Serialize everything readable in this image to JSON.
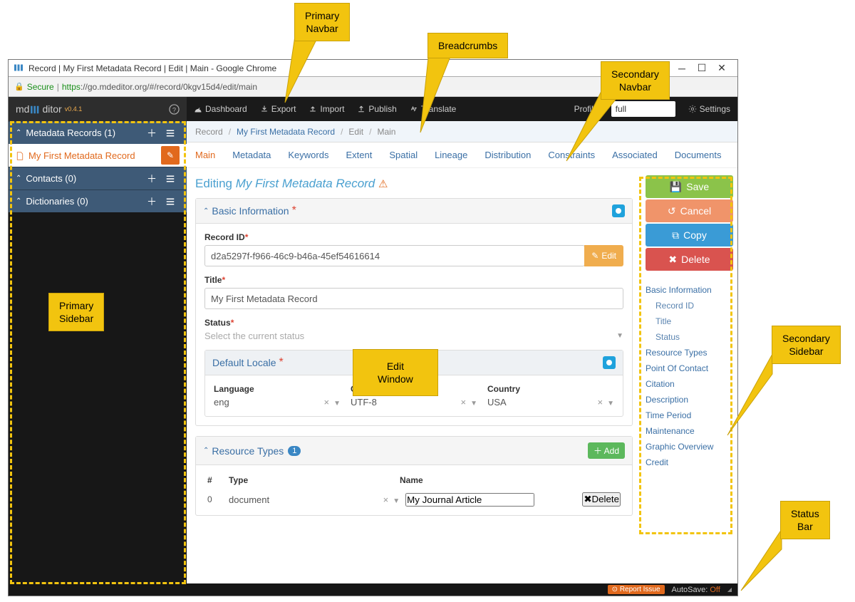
{
  "window": {
    "title": "Record | My First Metadata Record | Edit | Main - Google Chrome",
    "url_scheme": "https",
    "secure_label": "Secure",
    "url_host_path": "://go.mdeditor.org/#/record/0kgv15d4/edit/main"
  },
  "brand": {
    "pre": "md",
    "mid": "E",
    "post": "ditor",
    "version": "v0.4.1"
  },
  "sidebar": {
    "groups": [
      {
        "label": "Metadata Records (1)"
      },
      {
        "label": "Contacts (0)"
      },
      {
        "label": "Dictionaries (0)"
      }
    ],
    "active_item": "My First Metadata Record"
  },
  "primary_nav": {
    "items": [
      "Dashboard",
      "Export",
      "Import",
      "Publish",
      "Translate"
    ],
    "profile_label": "Profile",
    "profile_value": "full",
    "settings_label": "Settings"
  },
  "breadcrumbs": [
    "Record",
    "My First Metadata Record",
    "Edit",
    "Main"
  ],
  "secondary_nav": [
    "Main",
    "Metadata",
    "Keywords",
    "Extent",
    "Spatial",
    "Lineage",
    "Distribution",
    "Constraints",
    "Associated",
    "Documents"
  ],
  "editor": {
    "heading_prefix": "Editing ",
    "heading_subject": "My First Metadata Record",
    "basic": {
      "title": "Basic Information",
      "record_id_label": "Record ID",
      "record_id_value": "d2a5297f-f966-46c9-b46a-45ef54616614",
      "edit_btn": "Edit",
      "title_label": "Title",
      "title_value": "My First Metadata Record",
      "status_label": "Status",
      "status_placeholder": "Select the current status",
      "locale": {
        "title": "Default Locale",
        "language_label": "Language",
        "language_value": "eng",
        "charset_label": "Character Set",
        "charset_value": "UTF-8",
        "country_label": "Country",
        "country_value": "USA"
      }
    },
    "resource_types": {
      "title": "Resource Types",
      "count": "1",
      "add_label": "Add",
      "columns": {
        "idx": "#",
        "type": "Type",
        "name": "Name"
      },
      "rows": [
        {
          "idx": "0",
          "type": "document",
          "name": "My Journal Article",
          "delete": "Delete"
        }
      ]
    }
  },
  "actions": {
    "save": "Save",
    "cancel": "Cancel",
    "copy": "Copy",
    "delete": "Delete"
  },
  "toc": [
    {
      "label": "Basic Information",
      "sub": false
    },
    {
      "label": "Record ID",
      "sub": true
    },
    {
      "label": "Title",
      "sub": true
    },
    {
      "label": "Status",
      "sub": true
    },
    {
      "label": "Resource Types",
      "sub": false
    },
    {
      "label": "Point Of Contact",
      "sub": false
    },
    {
      "label": "Citation",
      "sub": false
    },
    {
      "label": "Description",
      "sub": false
    },
    {
      "label": "Time Period",
      "sub": false
    },
    {
      "label": "Maintenance",
      "sub": false
    },
    {
      "label": "Graphic Overview",
      "sub": false
    },
    {
      "label": "Credit",
      "sub": false
    }
  ],
  "status_bar": {
    "report": "Report Issue",
    "autosave_label": "AutoSave:",
    "autosave_value": "Off"
  },
  "callouts": {
    "primary_navbar": "Primary\nNavbar",
    "breadcrumbs": "Breadcrumbs",
    "secondary_navbar": "Secondary\nNavbar",
    "primary_sidebar": "Primary\nSidebar",
    "edit_window": "Edit\nWindow",
    "secondary_sidebar": "Secondary\nSidebar",
    "status_bar": "Status\nBar"
  }
}
